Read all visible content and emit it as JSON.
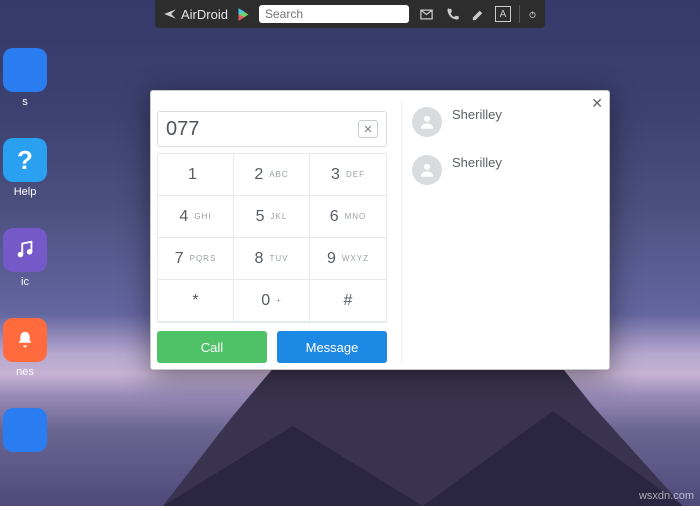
{
  "topbar": {
    "brand": "AirDroid",
    "search_placeholder": "Search",
    "search_value": ""
  },
  "apps": [
    {
      "id": "os",
      "label": "s",
      "color": "#2a7df0"
    },
    {
      "id": "help",
      "label": "Help",
      "color": "#2aa0f0"
    },
    {
      "id": "music",
      "label": "ic",
      "color": "#7659c9"
    },
    {
      "id": "nes",
      "label": "nes",
      "color": "#ff6b3d"
    },
    {
      "id": "last",
      "label": "",
      "color": "#2a7df0"
    }
  ],
  "dialer": {
    "entered_number": "077",
    "keys": [
      {
        "main": "1",
        "letters": ""
      },
      {
        "main": "2",
        "letters": "ABC"
      },
      {
        "main": "3",
        "letters": "DEF"
      },
      {
        "main": "4",
        "letters": "GHI"
      },
      {
        "main": "5",
        "letters": "JKL"
      },
      {
        "main": "6",
        "letters": "MNO"
      },
      {
        "main": "7",
        "letters": "PQRS"
      },
      {
        "main": "8",
        "letters": "TUV"
      },
      {
        "main": "9",
        "letters": "WXYZ"
      },
      {
        "main": "*",
        "letters": ""
      },
      {
        "main": "0",
        "letters": "+"
      },
      {
        "main": "#",
        "letters": ""
      }
    ],
    "call_label": "Call",
    "message_label": "Message"
  },
  "contacts": [
    {
      "name": "Sherilley"
    },
    {
      "name": "Sherilley"
    }
  ],
  "watermark": "wsxdn.com"
}
